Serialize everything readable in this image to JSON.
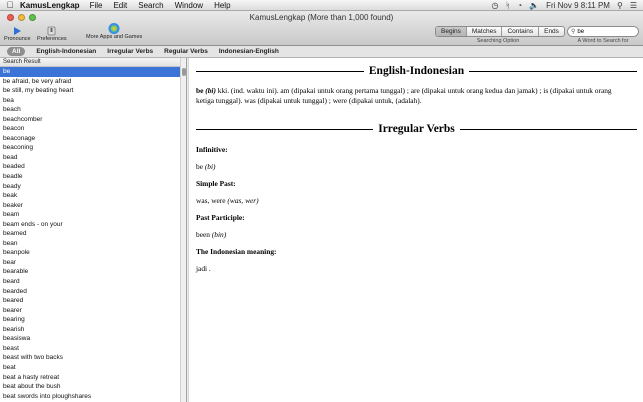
{
  "menubar": {
    "app_name": "KamusLengkap",
    "items": [
      "File",
      "Edit",
      "Search",
      "Window",
      "Help"
    ],
    "clock": "Fri Nov 9  8:11 PM"
  },
  "window": {
    "title": "KamusLengkap (More than 1,000 found)"
  },
  "toolbar": {
    "pronounce_label": "Pronounce",
    "preferences_label": "Preferences",
    "more_apps_label": "More Apps and Games",
    "search_options": [
      "Begins",
      "Matches",
      "Contains",
      "Ends"
    ],
    "selected_option": "Begins",
    "search_option_caption": "Searching Option",
    "search_value": "be",
    "search_caption": "A Word to Search for"
  },
  "filters": {
    "items": [
      "All",
      "English-Indonesian",
      "Irregular Verbs",
      "Regular Verbs",
      "Indonesian-English"
    ],
    "selected": "All"
  },
  "sidebar": {
    "header": "Search Result",
    "selected": "be",
    "results": [
      "be",
      "be afraid, be very afraid",
      "be still, my beating heart",
      "bea",
      "beach",
      "beachcomber",
      "beacon",
      "beaconage",
      "beaconing",
      "bead",
      "beaded",
      "beadle",
      "beady",
      "beak",
      "beaker",
      "beam",
      "beam ends - on your",
      "beamed",
      "bean",
      "beanpole",
      "bear",
      "bearable",
      "beard",
      "bearded",
      "beared",
      "bearer",
      "bearing",
      "bearish",
      "beasiswa",
      "beast",
      "beast with two backs",
      "beat",
      "beat a hasty retreat",
      "beat about the bush",
      "beat swords into ploughshares"
    ]
  },
  "content": {
    "section1_title": "English-Indonesian",
    "definition_head": "be",
    "definition_pron": "(bi)",
    "definition_line1": " kki. (ind. waktu ini). am (dipakai untuk orang pertama tunggal) ; are (dipakai untuk orang kedua dan jamak) ; is (dipakai untuk orang",
    "definition_line2": "ketiga tunggal). was (dipakai untuk tunggal) ; were (dipakai untuk, (adalah).",
    "section2_title": "Irregular Verbs",
    "infinitive_label": "Infinitive:",
    "infinitive_word": "be",
    "infinitive_pron": "(bi)",
    "simple_past_label": "Simple Past:",
    "simple_past_words": "was, were",
    "simple_past_pron": "(was, wer)",
    "past_participle_label": "Past Participle:",
    "past_participle_word": "been",
    "past_participle_pron": "(bin)",
    "meaning_label": "The Indonesian meaning:",
    "meaning_value": "jadi ."
  }
}
